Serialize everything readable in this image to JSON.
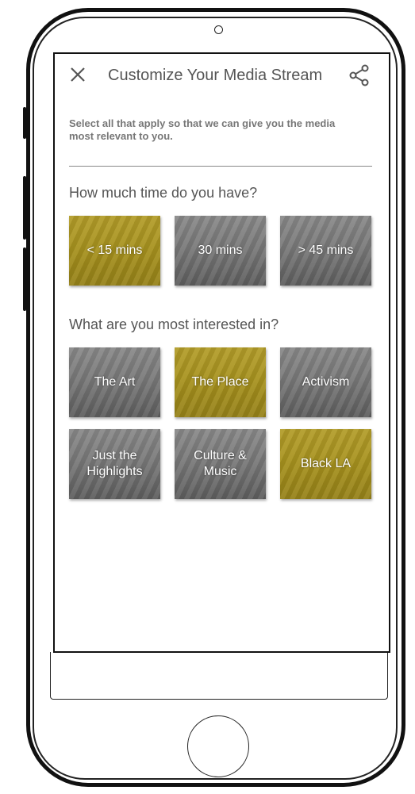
{
  "header": {
    "title": "Customize Your Media Stream",
    "close_icon": "close-icon",
    "share_icon": "share-icon"
  },
  "intro": {
    "text": "Select all that apply so that we can give you the media most relevant to you."
  },
  "time_section": {
    "label": "How much time do you have?",
    "options": [
      {
        "label": "< 15 mins",
        "selected": true
      },
      {
        "label": "30 mins",
        "selected": false
      },
      {
        "label": "> 45 mins",
        "selected": false
      }
    ]
  },
  "interest_section": {
    "label": "What are you most interested in?",
    "options": [
      {
        "label": "The Art",
        "selected": false
      },
      {
        "label": "The Place",
        "selected": true
      },
      {
        "label": "Activism",
        "selected": false
      },
      {
        "label": "Just the Highlights",
        "selected": false
      },
      {
        "label": "Culture & Music",
        "selected": false
      },
      {
        "label": "Black LA",
        "selected": true
      }
    ]
  },
  "colors": {
    "selected": "#a8931f",
    "unselected": "#777777",
    "text": "#555555"
  }
}
